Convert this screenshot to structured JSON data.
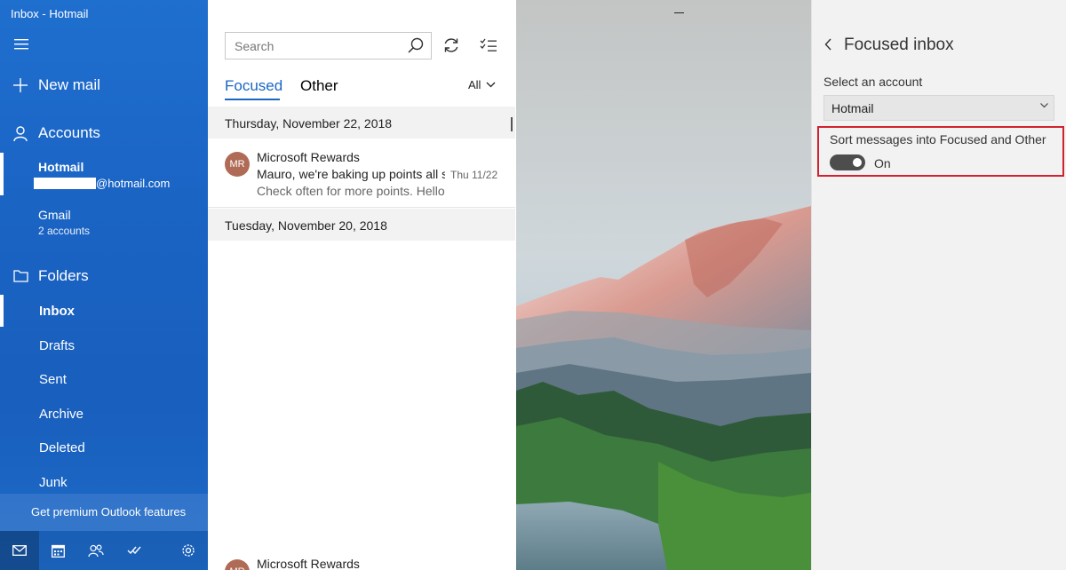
{
  "window": {
    "title": "Inbox - Hotmail"
  },
  "sidebar": {
    "new_mail": "New mail",
    "accounts_heading": "Accounts",
    "accounts": [
      {
        "name": "Hotmail",
        "email": "@hotmail.com"
      },
      {
        "name": "Gmail",
        "sub": "2 accounts"
      }
    ],
    "folders_heading": "Folders",
    "folders": [
      "Inbox",
      "Drafts",
      "Sent",
      "Archive",
      "Deleted",
      "Junk"
    ],
    "premium": "Get premium Outlook features"
  },
  "list": {
    "search_placeholder": "Search",
    "tabs": [
      "Focused",
      "Other"
    ],
    "filter": "All",
    "groups": [
      {
        "date": "Thursday, November 22, 2018"
      },
      {
        "date": "Tuesday, November 20, 2018"
      }
    ],
    "messages": [
      {
        "initials": "MR",
        "from": "Microsoft Rewards",
        "subject": "Mauro, we're baking up points all s",
        "preview": "Check often for more points. Hello",
        "date": "Thu 11/22"
      },
      {
        "initials": "MR",
        "from": "Microsoft Rewards"
      }
    ]
  },
  "panel": {
    "title": "Focused inbox",
    "select_label": "Select an account",
    "selected_account": "Hotmail",
    "sort_label": "Sort messages into Focused and Other",
    "toggle_state": "On"
  },
  "colors": {
    "accent": "#1a66c2",
    "sidebar": "#1a64c4",
    "highlight": "#d0232f",
    "avatar": "#b06b57"
  }
}
